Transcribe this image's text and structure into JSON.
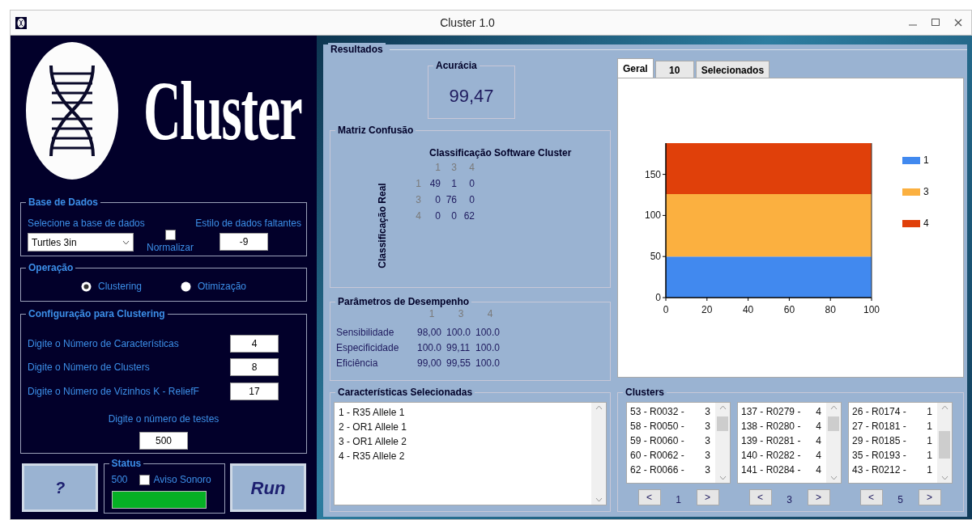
{
  "window": {
    "title": "Cluster 1.0"
  },
  "logo": {
    "text": "Cluster"
  },
  "database": {
    "title": "Base de Dados",
    "select_label": "Selecione a base de dados",
    "select_value": "Turtles 3in",
    "normalize": {
      "label": "Normalizar",
      "checked": false
    },
    "missing_label": "Estilo de dados faltantes",
    "missing_value": "-9"
  },
  "operation": {
    "title": "Operação",
    "options": [
      {
        "label": "Clustering",
        "selected": true
      },
      {
        "label": "Otimização",
        "selected": false
      }
    ]
  },
  "config": {
    "title": "Configuração para Clustering",
    "fields": [
      {
        "label": "Digite o Número de Características",
        "value": "4"
      },
      {
        "label": "Digite o Número de Clusters",
        "value": "8"
      },
      {
        "label": "Digite o Número de Vizinhos K - ReliefF",
        "value": "17"
      }
    ],
    "tests_label": "Digite o número de testes",
    "tests_value": "500"
  },
  "help_button": "?",
  "status": {
    "title": "Status",
    "count": "500",
    "sound": {
      "label": "Aviso Sonoro",
      "checked": false
    },
    "level": 1
  },
  "run_button": "Run",
  "results": {
    "title": "Resultados",
    "accuracy": {
      "title": "Acurácia",
      "value": "99,47"
    },
    "confusion": {
      "title": "Matriz Confusão",
      "col_title": "Classificação Software Cluster",
      "row_title": "Classificação Real",
      "columns": [
        "1",
        "3",
        "4"
      ],
      "rows": [
        {
          "label": "1",
          "cells": [
            "49",
            "1",
            "0"
          ]
        },
        {
          "label": "3",
          "cells": [
            "0",
            "76",
            "0"
          ]
        },
        {
          "label": "4",
          "cells": [
            "0",
            "0",
            "62"
          ]
        }
      ]
    },
    "performance": {
      "title": "Parâmetros de Desempenho",
      "columns": [
        "1",
        "3",
        "4"
      ],
      "rows": [
        {
          "label": "Sensibilidade",
          "cells": [
            "98,00",
            "100.0",
            "100.0"
          ]
        },
        {
          "label": "Especificidade",
          "cells": [
            "100.0",
            "99,11",
            "100.0"
          ]
        },
        {
          "label": "Eficiência",
          "cells": [
            "99,00",
            "99,55",
            "100.0"
          ]
        }
      ]
    }
  },
  "tabs": [
    {
      "label": "Geral",
      "selected": true
    },
    {
      "label": "10",
      "selected": false
    },
    {
      "label": "Selecionados",
      "selected": false
    }
  ],
  "chart_data": {
    "type": "area",
    "stacked": true,
    "legend": "right",
    "x": [
      0,
      100
    ],
    "xlim": [
      0,
      100
    ],
    "ylim": [
      0,
      188
    ],
    "xticks": [
      0,
      20,
      40,
      60,
      80,
      100
    ],
    "yticks": [
      0,
      50,
      100,
      150
    ],
    "series": [
      {
        "name": "1",
        "color": "#4189ef",
        "values": [
          50,
          50
        ]
      },
      {
        "name": "3",
        "color": "#fbb040",
        "values": [
          76,
          76
        ]
      },
      {
        "name": "4",
        "color": "#e0400a",
        "values": [
          62,
          62
        ]
      }
    ]
  },
  "features": {
    "title": "Características Selecionadas",
    "items": [
      "1 - R35 Allele 1",
      "2 - OR1 Allele 1",
      "3 - OR1 Allele 2",
      "4 - R35 Allele 2"
    ]
  },
  "clusters": {
    "title": "Clusters",
    "lists": [
      {
        "items": [
          {
            "name": "53 - R0032 -",
            "cluster": "3"
          },
          {
            "name": "58 - R0050 -",
            "cluster": "3"
          },
          {
            "name": "59 - R0060 -",
            "cluster": "3"
          },
          {
            "name": "60 - R0062 -",
            "cluster": "3"
          },
          {
            "name": "62 - R0066 -",
            "cluster": "3"
          }
        ],
        "prev": "<",
        "page": "1",
        "next": ">"
      },
      {
        "items": [
          {
            "name": "137 - R0279 -",
            "cluster": "4"
          },
          {
            "name": "138 - R0280 -",
            "cluster": "4"
          },
          {
            "name": "139 - R0281 -",
            "cluster": "4"
          },
          {
            "name": "140 - R0282 -",
            "cluster": "4"
          },
          {
            "name": "141 - R0284 -",
            "cluster": "4"
          }
        ],
        "prev": "<",
        "page": "3",
        "next": ">"
      },
      {
        "items": [
          {
            "name": "26 - R0174 -",
            "cluster": "1"
          },
          {
            "name": "27 - R0181 -",
            "cluster": "1"
          },
          {
            "name": "29 - R0185 -",
            "cluster": "1"
          },
          {
            "name": "35 - R0193 -",
            "cluster": "1"
          },
          {
            "name": "43 - R0212 -",
            "cluster": "1"
          }
        ],
        "prev": "<",
        "page": "5",
        "next": ">"
      }
    ]
  }
}
